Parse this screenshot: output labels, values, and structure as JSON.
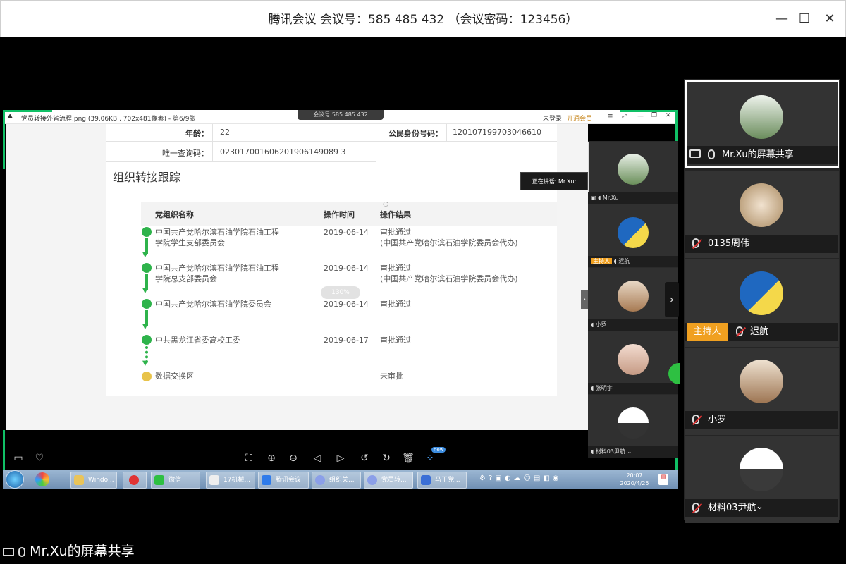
{
  "window": {
    "title": "腾讯会议 会议号：585 485 432 （会议密码：123456）",
    "minimize": "—",
    "maximize": "☐",
    "close": "✕"
  },
  "viewer": {
    "file_title": "党员转接外省流程.png (39.06KB , 702x481像素) - 第6/9张",
    "meeting_pill": "会议号 585 485 432",
    "login": "未登录",
    "vip": "开通会员",
    "zoom": "130%",
    "speaking_tip": "正在讲话: Mr.Xu;"
  },
  "document": {
    "age_label": "年龄：",
    "age_value": "22",
    "id_label": "公民身份号码：",
    "id_value": "120107199703046610",
    "query_label": "唯一查询码：",
    "query_value": "023017001606201906149089 3",
    "section_title": "组织转接跟踪",
    "columns": [
      "党组织名称",
      "操作时间",
      "操作结果"
    ],
    "rows": [
      {
        "org": "中国共产党哈尔滨石油学院石油工程\n学院学生支部委员会",
        "time": "2019-06-14",
        "result": "审批通过\n(中国共产党哈尔滨石油学院委员会代办)"
      },
      {
        "org": "中国共产党哈尔滨石油学院石油工程\n学院总支部委员会",
        "time": "2019-06-14",
        "result": "审批通过\n(中国共产党哈尔滨石油学院委员会代办)"
      },
      {
        "org": "中国共产党哈尔滨石油学院委员会",
        "time": "2019-06-14",
        "result": "审批通过"
      },
      {
        "org": "中共黑龙江省委高校工委",
        "time": "2019-06-17",
        "result": "审批通过"
      },
      {
        "org": "数据交换区",
        "time": "",
        "result": "未审批"
      }
    ]
  },
  "toolbar": {
    "new_badge": "new"
  },
  "taskbar": {
    "items": [
      "Windo...",
      "",
      "微信",
      "17机械...",
      "腾讯会议",
      "组织关...",
      "党员转...",
      "马干党..."
    ],
    "time": "20:07",
    "date": "2020/4/25"
  },
  "inner_participants": [
    {
      "name": "Mr.Xu"
    },
    {
      "name": "迟航",
      "host": "主持人"
    },
    {
      "name": "小罗"
    },
    {
      "name": "张明宇"
    },
    {
      "name": "材料03尹航"
    }
  ],
  "participants": [
    {
      "name": "Mr.Xu的屏幕共享"
    },
    {
      "name": "0135周伟"
    },
    {
      "name": "迟航",
      "host": "主持人"
    },
    {
      "name": "小罗"
    },
    {
      "name": "材料03尹航"
    }
  ],
  "bottom_label": "Mr.Xu的屏幕共享",
  "colors": {
    "accent_green": "#10c066",
    "host_orange": "#f0a020",
    "red_line": "#d93b3b"
  }
}
